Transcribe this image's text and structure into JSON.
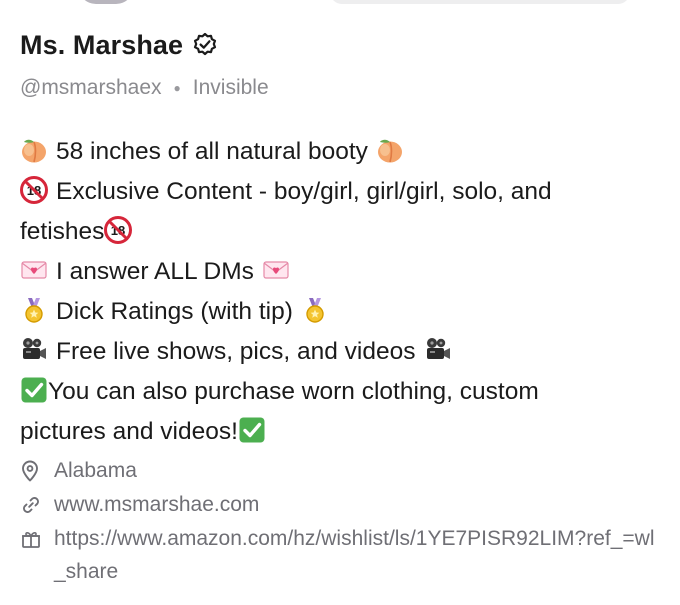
{
  "profile": {
    "name": "Ms. Marshae",
    "handle": "@msmarshaex",
    "status": "Invisible",
    "verified_icon": "verified-badge-icon"
  },
  "bio": {
    "line1": "58 inches of all natural booty",
    "line2": "Exclusive Content - boy/girl, girl/girl, solo, and",
    "line3": "fetishes",
    "line4": "I answer ALL DMs",
    "line5": "Dick Ratings (with tip)",
    "line6": "Free live shows, pics, and videos",
    "line7": "You can also purchase worn clothing, custom",
    "line8": "pictures and videos!"
  },
  "meta": {
    "location": "Alabama",
    "website": "www.msmarshae.com",
    "wishlist": "https://www.amazon.com/hz/wishlist/ls/1YE7PISR92LIM?ref_=wl_share"
  },
  "colors": {
    "accent": "#1b1b1b",
    "muted": "#8a8a8e",
    "check_green": "#4caf50"
  }
}
